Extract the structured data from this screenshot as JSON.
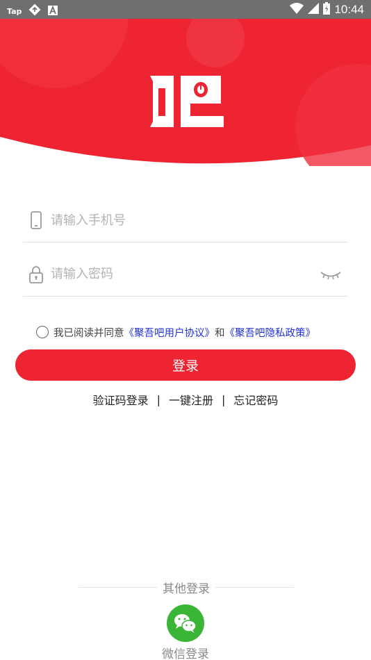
{
  "status_bar": {
    "app_badge": "Tap",
    "time": "10:44",
    "icons": [
      "tap-app-icon",
      "sync-icon",
      "a-notification-icon",
      "wifi-icon",
      "signal-icon",
      "battery-icon"
    ]
  },
  "header": {
    "logo_text": "吧",
    "background_color": "#ee2433"
  },
  "form": {
    "phone": {
      "value": "",
      "placeholder": "请输入手机号"
    },
    "password": {
      "value": "",
      "placeholder": "请输入密码"
    }
  },
  "agreement": {
    "checked": false,
    "prefix": "我已阅读并同意",
    "user_agreement": "《聚吾吧用户协议》",
    "and": "和",
    "privacy_policy": "《聚吾吧隐私政策》"
  },
  "login_button": {
    "label": "登录",
    "color": "#ee2433"
  },
  "links": {
    "sms_login": "验证码登录",
    "sep1": "|",
    "quick_register": "一键注册",
    "sep2": "|",
    "forgot_password": "忘记密码"
  },
  "other_login": {
    "title": "其他登录",
    "wechat_label": "微信登录",
    "wechat_color": "#3bb536"
  }
}
